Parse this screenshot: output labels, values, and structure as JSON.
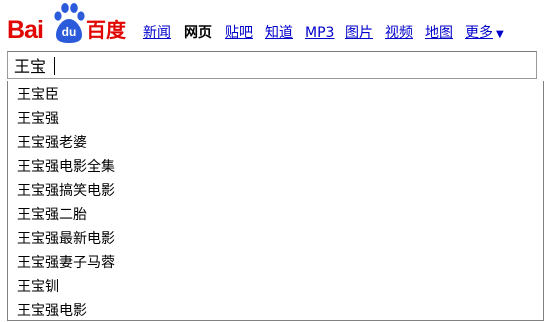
{
  "logo": {
    "prefix": "Bai",
    "paw_text": "du",
    "suffix": "百度",
    "color": "#e10601",
    "paw_color": "#2b5bdb"
  },
  "nav": {
    "items": [
      {
        "label": "新闻",
        "current": false
      },
      {
        "label": "网页",
        "current": true
      },
      {
        "label": "贴吧",
        "current": false
      },
      {
        "label": "知道",
        "current": false
      },
      {
        "label": "MP3",
        "current": false
      },
      {
        "label": "图片",
        "current": false
      },
      {
        "label": "视频",
        "current": false
      },
      {
        "label": "地图",
        "current": false
      }
    ],
    "more": {
      "label": "更多",
      "icon": "triangle-down-icon"
    },
    "link_color": "#0000cc"
  },
  "search": {
    "value": "王宝",
    "placeholder": ""
  },
  "suggestions": [
    "王宝臣",
    "王宝强",
    "王宝强老婆",
    "王宝强电影全集",
    "王宝强搞笑电影",
    "王宝强二胎",
    "王宝强最新电影",
    "王宝强妻子马蓉",
    "王宝钏",
    "王宝强电影"
  ]
}
